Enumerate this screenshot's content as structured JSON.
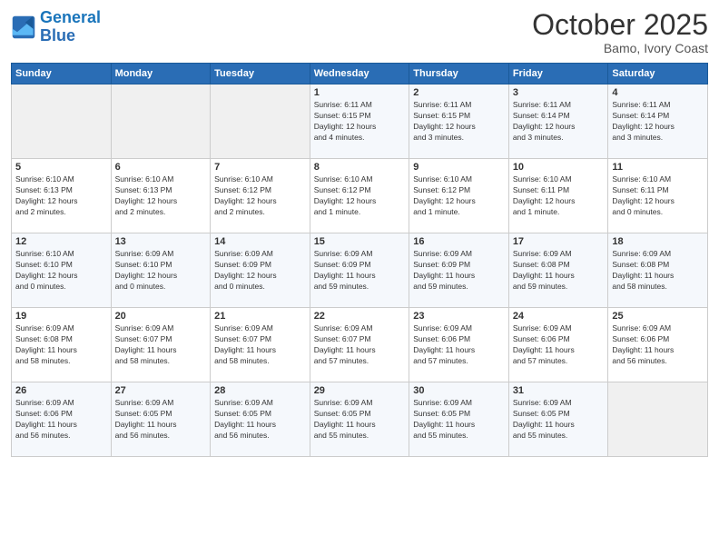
{
  "header": {
    "logo_line1": "General",
    "logo_line2": "Blue",
    "month": "October 2025",
    "location": "Bamo, Ivory Coast"
  },
  "weekdays": [
    "Sunday",
    "Monday",
    "Tuesday",
    "Wednesday",
    "Thursday",
    "Friday",
    "Saturday"
  ],
  "weeks": [
    [
      {
        "day": "",
        "info": ""
      },
      {
        "day": "",
        "info": ""
      },
      {
        "day": "",
        "info": ""
      },
      {
        "day": "1",
        "info": "Sunrise: 6:11 AM\nSunset: 6:15 PM\nDaylight: 12 hours\nand 4 minutes."
      },
      {
        "day": "2",
        "info": "Sunrise: 6:11 AM\nSunset: 6:15 PM\nDaylight: 12 hours\nand 3 minutes."
      },
      {
        "day": "3",
        "info": "Sunrise: 6:11 AM\nSunset: 6:14 PM\nDaylight: 12 hours\nand 3 minutes."
      },
      {
        "day": "4",
        "info": "Sunrise: 6:11 AM\nSunset: 6:14 PM\nDaylight: 12 hours\nand 3 minutes."
      }
    ],
    [
      {
        "day": "5",
        "info": "Sunrise: 6:10 AM\nSunset: 6:13 PM\nDaylight: 12 hours\nand 2 minutes."
      },
      {
        "day": "6",
        "info": "Sunrise: 6:10 AM\nSunset: 6:13 PM\nDaylight: 12 hours\nand 2 minutes."
      },
      {
        "day": "7",
        "info": "Sunrise: 6:10 AM\nSunset: 6:12 PM\nDaylight: 12 hours\nand 2 minutes."
      },
      {
        "day": "8",
        "info": "Sunrise: 6:10 AM\nSunset: 6:12 PM\nDaylight: 12 hours\nand 1 minute."
      },
      {
        "day": "9",
        "info": "Sunrise: 6:10 AM\nSunset: 6:12 PM\nDaylight: 12 hours\nand 1 minute."
      },
      {
        "day": "10",
        "info": "Sunrise: 6:10 AM\nSunset: 6:11 PM\nDaylight: 12 hours\nand 1 minute."
      },
      {
        "day": "11",
        "info": "Sunrise: 6:10 AM\nSunset: 6:11 PM\nDaylight: 12 hours\nand 0 minutes."
      }
    ],
    [
      {
        "day": "12",
        "info": "Sunrise: 6:10 AM\nSunset: 6:10 PM\nDaylight: 12 hours\nand 0 minutes."
      },
      {
        "day": "13",
        "info": "Sunrise: 6:09 AM\nSunset: 6:10 PM\nDaylight: 12 hours\nand 0 minutes."
      },
      {
        "day": "14",
        "info": "Sunrise: 6:09 AM\nSunset: 6:09 PM\nDaylight: 12 hours\nand 0 minutes."
      },
      {
        "day": "15",
        "info": "Sunrise: 6:09 AM\nSunset: 6:09 PM\nDaylight: 11 hours\nand 59 minutes."
      },
      {
        "day": "16",
        "info": "Sunrise: 6:09 AM\nSunset: 6:09 PM\nDaylight: 11 hours\nand 59 minutes."
      },
      {
        "day": "17",
        "info": "Sunrise: 6:09 AM\nSunset: 6:08 PM\nDaylight: 11 hours\nand 59 minutes."
      },
      {
        "day": "18",
        "info": "Sunrise: 6:09 AM\nSunset: 6:08 PM\nDaylight: 11 hours\nand 58 minutes."
      }
    ],
    [
      {
        "day": "19",
        "info": "Sunrise: 6:09 AM\nSunset: 6:08 PM\nDaylight: 11 hours\nand 58 minutes."
      },
      {
        "day": "20",
        "info": "Sunrise: 6:09 AM\nSunset: 6:07 PM\nDaylight: 11 hours\nand 58 minutes."
      },
      {
        "day": "21",
        "info": "Sunrise: 6:09 AM\nSunset: 6:07 PM\nDaylight: 11 hours\nand 58 minutes."
      },
      {
        "day": "22",
        "info": "Sunrise: 6:09 AM\nSunset: 6:07 PM\nDaylight: 11 hours\nand 57 minutes."
      },
      {
        "day": "23",
        "info": "Sunrise: 6:09 AM\nSunset: 6:06 PM\nDaylight: 11 hours\nand 57 minutes."
      },
      {
        "day": "24",
        "info": "Sunrise: 6:09 AM\nSunset: 6:06 PM\nDaylight: 11 hours\nand 57 minutes."
      },
      {
        "day": "25",
        "info": "Sunrise: 6:09 AM\nSunset: 6:06 PM\nDaylight: 11 hours\nand 56 minutes."
      }
    ],
    [
      {
        "day": "26",
        "info": "Sunrise: 6:09 AM\nSunset: 6:06 PM\nDaylight: 11 hours\nand 56 minutes."
      },
      {
        "day": "27",
        "info": "Sunrise: 6:09 AM\nSunset: 6:05 PM\nDaylight: 11 hours\nand 56 minutes."
      },
      {
        "day": "28",
        "info": "Sunrise: 6:09 AM\nSunset: 6:05 PM\nDaylight: 11 hours\nand 56 minutes."
      },
      {
        "day": "29",
        "info": "Sunrise: 6:09 AM\nSunset: 6:05 PM\nDaylight: 11 hours\nand 55 minutes."
      },
      {
        "day": "30",
        "info": "Sunrise: 6:09 AM\nSunset: 6:05 PM\nDaylight: 11 hours\nand 55 minutes."
      },
      {
        "day": "31",
        "info": "Sunrise: 6:09 AM\nSunset: 6:05 PM\nDaylight: 11 hours\nand 55 minutes."
      },
      {
        "day": "",
        "info": ""
      }
    ]
  ]
}
